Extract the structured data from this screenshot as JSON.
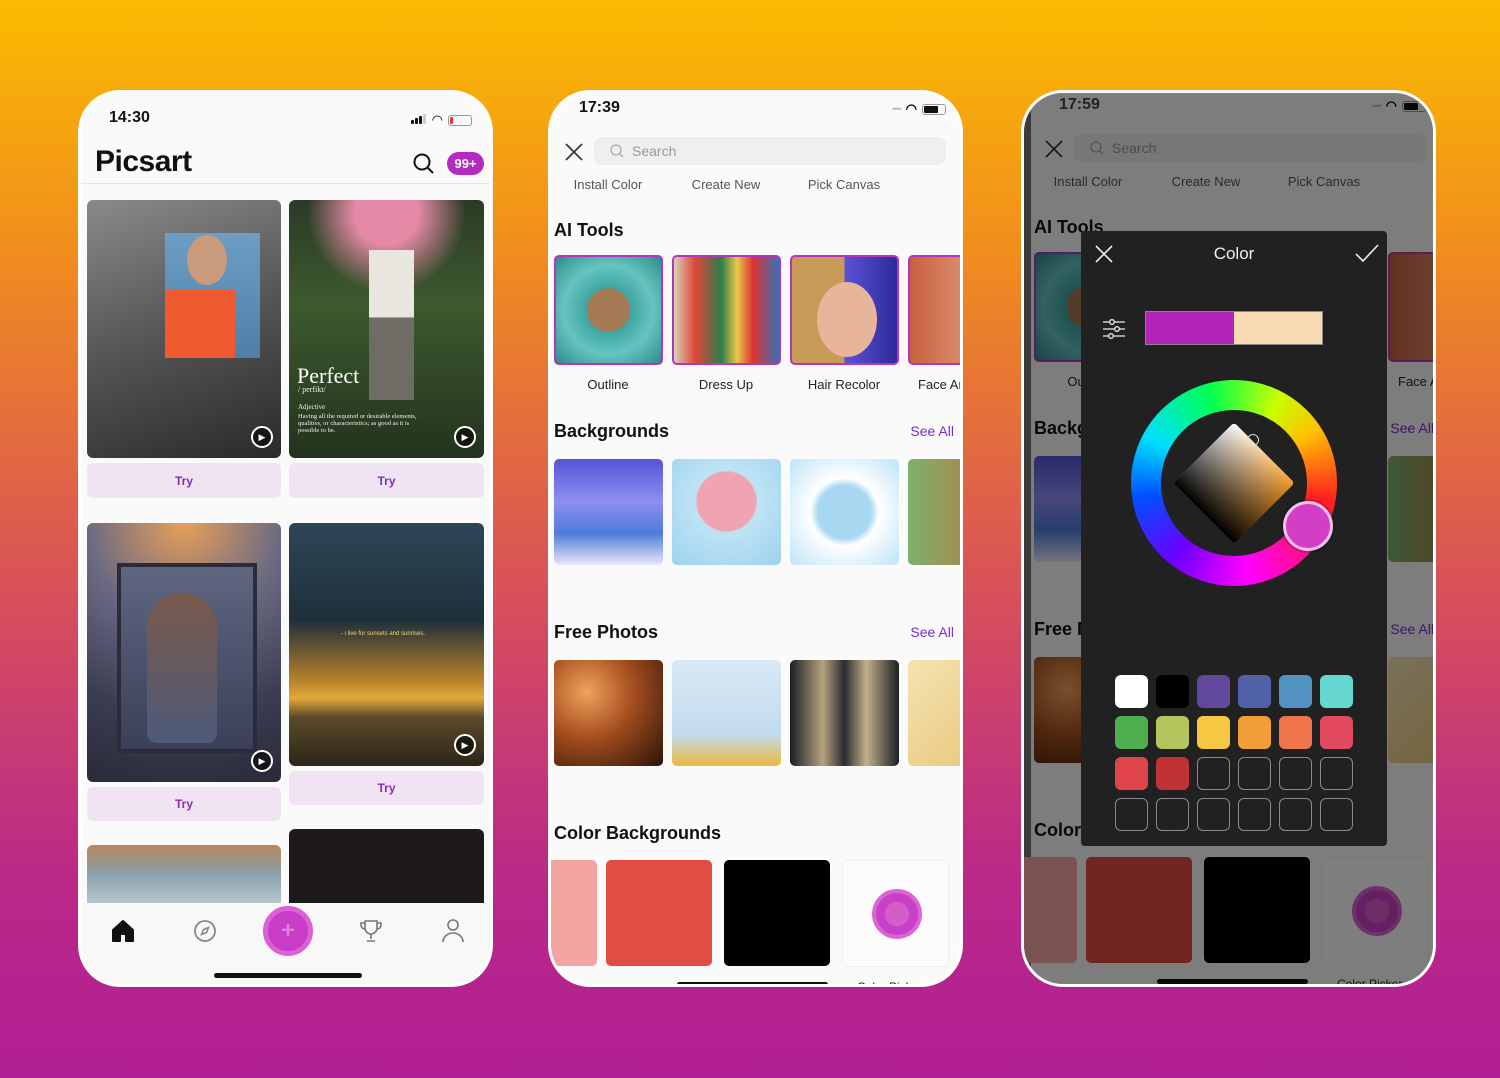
{
  "phone1": {
    "status": {
      "time": "14:30"
    },
    "header": {
      "logo": "Picsart",
      "notification_badge": "99+",
      "search_icon": "search-icon"
    },
    "cards": [
      {
        "action": "Try"
      },
      {
        "action": "Try",
        "overlay_title": "Perfect",
        "overlay_phonetic": "/ perfikt/",
        "overlay_pos": "Adjective",
        "overlay_definition": "Having all the required or desirable elements, qualities, or characteristics; as good as it is possible to be."
      },
      {
        "action": "Try"
      },
      {
        "action": "Try",
        "overlay_caption": "- i live for sunsets and sunrises."
      }
    ],
    "bottom_nav": [
      "home-icon",
      "explore-icon",
      "create-plus-icon",
      "trophy-icon",
      "profile-icon"
    ],
    "accent": "#c831c0"
  },
  "phone2": {
    "status": {
      "time": "17:39"
    },
    "search": {
      "placeholder": "Search"
    },
    "tabs": [
      "Install Color",
      "Create New",
      "Pick Canvas"
    ],
    "ai_tools": {
      "title": "AI Tools",
      "items": [
        "Outline",
        "Dress Up",
        "Hair Recolor",
        "Face Art"
      ]
    },
    "backgrounds": {
      "title": "Backgrounds",
      "see_all": "See All"
    },
    "free_photos": {
      "title": "Free Photos",
      "see_all": "See All"
    },
    "color_backgrounds": {
      "title": "Color Backgrounds",
      "swatches": [
        "#f3a5a2",
        "#e34c44",
        "#000000"
      ],
      "picker_label": "Color Picker"
    }
  },
  "phone3": {
    "status": {
      "time": "17:59"
    },
    "color_dialog": {
      "title": "Color",
      "previous_color": "#b324b9",
      "current_color": "#f8dab4",
      "swatches": [
        "#ffffff",
        "#000000",
        "#62489c",
        "#5161a8",
        "#5192c2",
        "#66d8d0",
        "#4fae4e",
        "#b3c55c",
        "#f7c744",
        "#f29e38",
        "#ef764b",
        "#e24a5f",
        "#e0444b",
        "#c03236"
      ],
      "empty_slots": 10,
      "selected_hue": "#d23fc4"
    }
  }
}
